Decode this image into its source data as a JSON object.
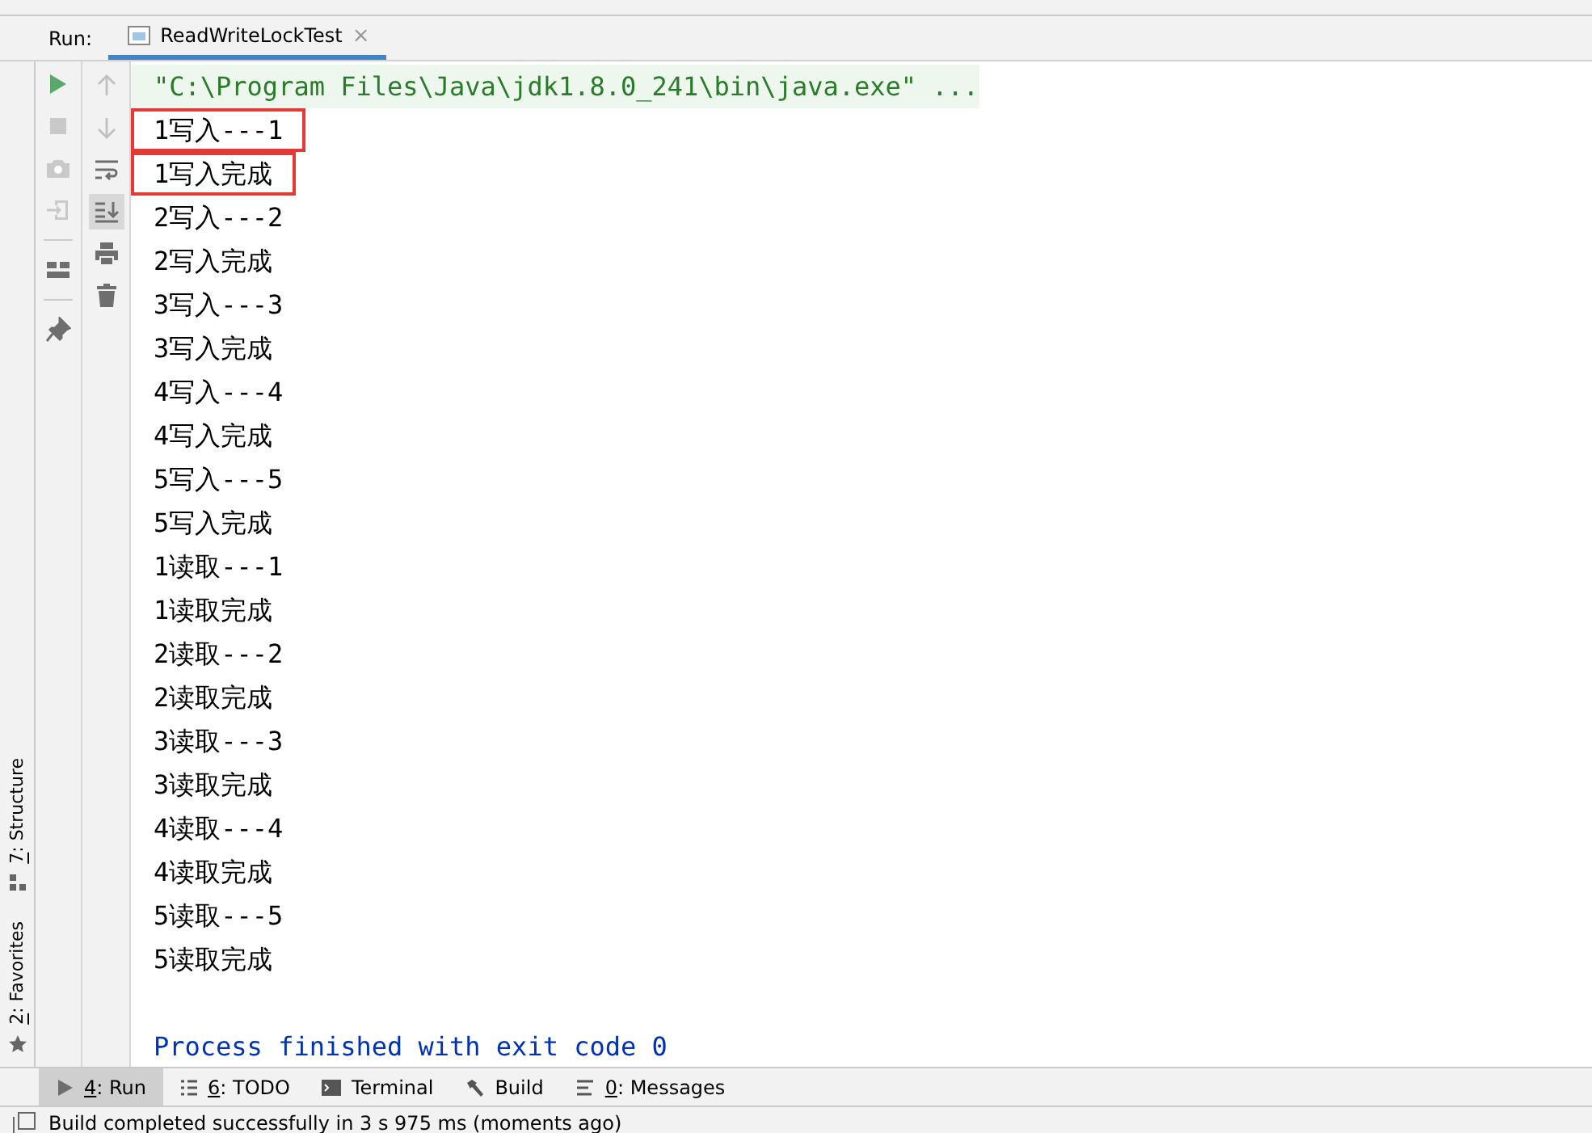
{
  "run_header": {
    "label": "Run:",
    "tabs": [
      {
        "title": "ReadWriteLockTest",
        "close": "×",
        "selected": true
      }
    ]
  },
  "toolbar_left": [
    {
      "kind": "run"
    },
    {
      "kind": "stop"
    },
    {
      "kind": "camera"
    },
    {
      "kind": "exit"
    },
    {
      "kind": "layout"
    },
    {
      "kind": "pin"
    }
  ],
  "toolbar_right": [
    {
      "kind": "up",
      "selected": false
    },
    {
      "kind": "down",
      "selected": false
    },
    {
      "kind": "wrap",
      "selected": false
    },
    {
      "kind": "scroll-end",
      "selected": true
    },
    {
      "kind": "print",
      "selected": false
    },
    {
      "kind": "trash",
      "selected": false
    }
  ],
  "console": {
    "command": "\"C:\\Program Files\\Java\\jdk1.8.0_241\\bin\\java.exe\" ...",
    "lines": [
      {
        "text": "1写入---1",
        "highlighted": true
      },
      {
        "text": "1写入完成",
        "highlighted": true
      },
      {
        "text": "2写入---2",
        "highlighted": false
      },
      {
        "text": "2写入完成",
        "highlighted": false
      },
      {
        "text": "3写入---3",
        "highlighted": false
      },
      {
        "text": "3写入完成",
        "highlighted": false
      },
      {
        "text": "4写入---4",
        "highlighted": false
      },
      {
        "text": "4写入完成",
        "highlighted": false
      },
      {
        "text": "5写入---5",
        "highlighted": false
      },
      {
        "text": "5写入完成",
        "highlighted": false
      },
      {
        "text": "1读取---1",
        "highlighted": false
      },
      {
        "text": "1读取完成",
        "highlighted": false
      },
      {
        "text": "2读取---2",
        "highlighted": false
      },
      {
        "text": "2读取完成",
        "highlighted": false
      },
      {
        "text": "3读取---3",
        "highlighted": false
      },
      {
        "text": "3读取完成",
        "highlighted": false
      },
      {
        "text": "4读取---4",
        "highlighted": false
      },
      {
        "text": "4读取完成",
        "highlighted": false
      },
      {
        "text": "5读取---5",
        "highlighted": false
      },
      {
        "text": "5读取完成",
        "highlighted": false
      }
    ],
    "exit_message": "Process finished with exit code 0"
  },
  "side_tabs": [
    {
      "kind": "structure",
      "mnemonic": "7",
      "label": ": Structure"
    },
    {
      "kind": "favorites",
      "mnemonic": "2",
      "label": ": Favorites"
    }
  ],
  "tool_tabs": [
    {
      "kind": "run",
      "mnemonic": "4",
      "label": ": Run",
      "selected": true
    },
    {
      "kind": "todo",
      "mnemonic": "6",
      "label": ": TODO",
      "selected": false
    },
    {
      "kind": "terminal",
      "label": "Terminal",
      "selected": false
    },
    {
      "kind": "build",
      "label": "Build",
      "selected": false
    },
    {
      "kind": "messages",
      "mnemonic": "0",
      "label": ": Messages",
      "selected": false
    }
  ],
  "status_bar": {
    "message": "Build completed successfully in 3 s 975 ms (moments ago)"
  }
}
